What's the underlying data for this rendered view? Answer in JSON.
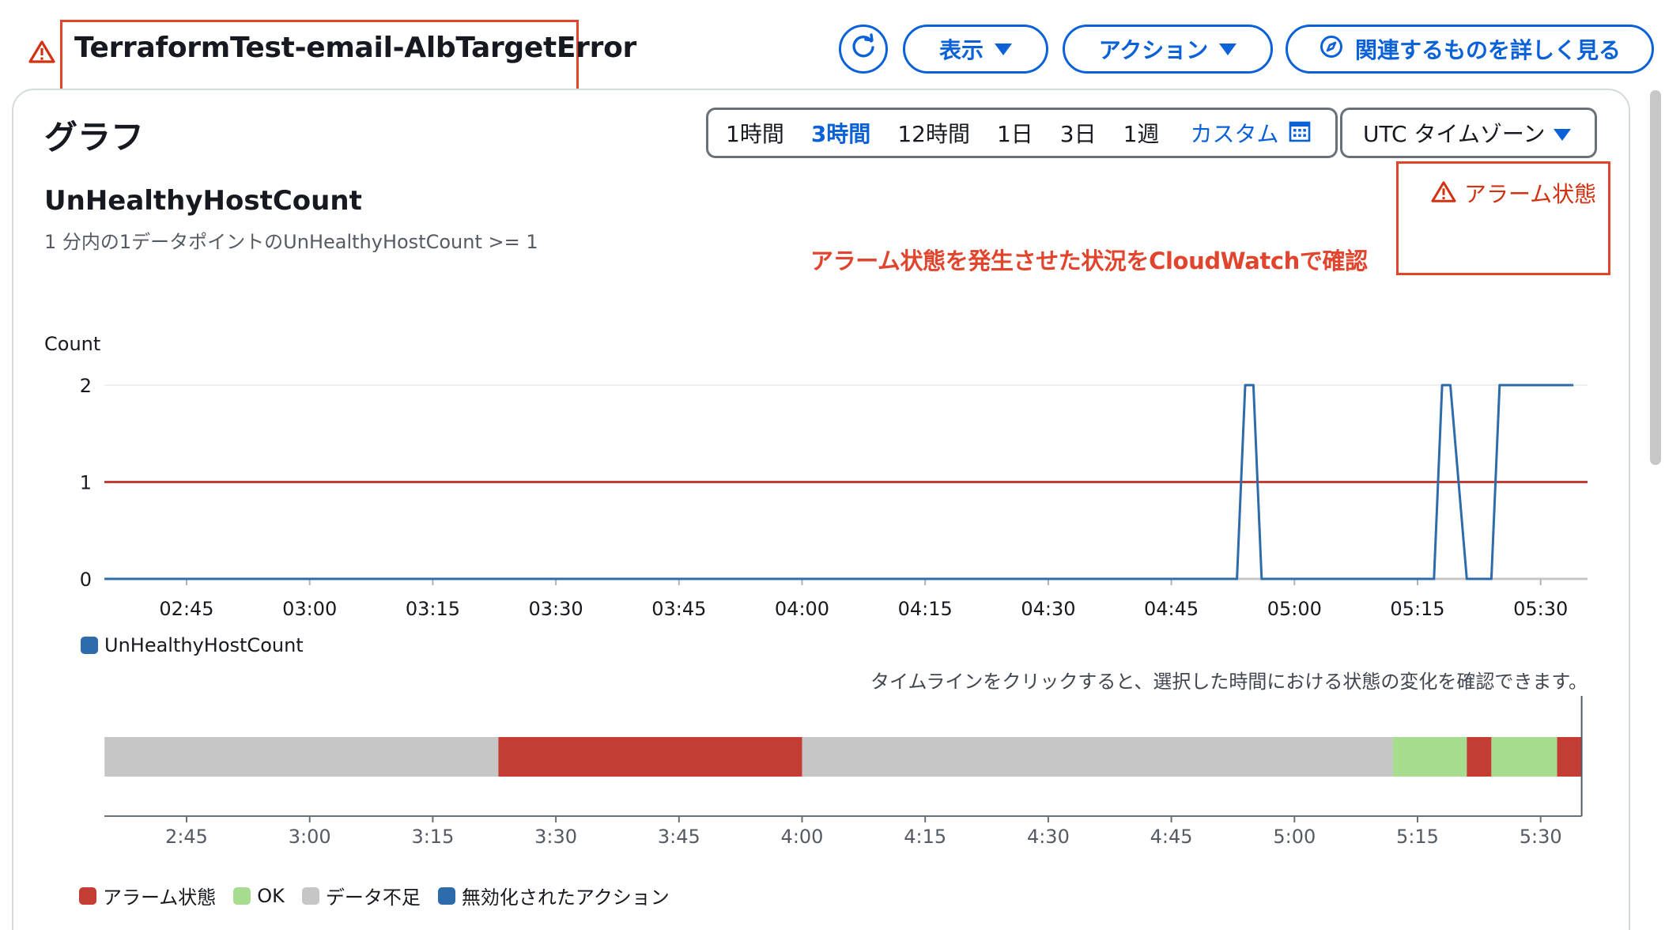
{
  "header": {
    "alarm_name": "TerraformTest-email-AlbTargetError",
    "buttons": {
      "view": "表示",
      "actions": "アクション",
      "related": "関連するものを詳しく見る"
    }
  },
  "graph": {
    "heading": "グラフ",
    "time_ranges": [
      "1時間",
      "3時間",
      "12時間",
      "1日",
      "3日",
      "1週",
      "カスタム"
    ],
    "selected_range": "3時間",
    "timezone": "UTC タイムゾーン",
    "metric_name": "UnHealthyHostCount",
    "condition": "1 分内の1データポイントのUnHealthyHostCount >= 1",
    "state_label": "アラーム状態",
    "annotation": "アラーム状態を発生させた状況をCloudWatchで確認",
    "timeline_hint": "タイムラインをクリックすると、選択した時間における状態の変化を確認できます。"
  },
  "chart_data": [
    {
      "type": "line",
      "ylabel": "Count",
      "ylim": [
        0,
        2
      ],
      "y_ticks": [
        "0",
        "1",
        "2"
      ],
      "x_ticks": [
        "02:45",
        "03:00",
        "03:15",
        "03:30",
        "03:45",
        "04:00",
        "04:15",
        "04:30",
        "04:45",
        "05:00",
        "05:15",
        "05:30"
      ],
      "threshold": 1,
      "series": [
        {
          "name": "UnHealthyHostCount",
          "color": "#2e6bab",
          "x": [
            "02:35",
            "04:53",
            "04:54",
            "04:55",
            "04:56",
            "05:17",
            "05:18",
            "05:19",
            "05:21",
            "05:24",
            "05:25",
            "05:34"
          ],
          "values": [
            0,
            0,
            2,
            2,
            0,
            0,
            2,
            2,
            0,
            0,
            2,
            2
          ]
        }
      ]
    },
    {
      "type": "timeline",
      "x_ticks": [
        "2:45",
        "3:00",
        "3:15",
        "3:30",
        "3:45",
        "4:00",
        "4:15",
        "4:30",
        "4:45",
        "5:00",
        "5:15",
        "5:30"
      ],
      "segments": [
        {
          "state": "insufficient",
          "start": "02:35",
          "end": "03:23"
        },
        {
          "state": "alarm",
          "start": "03:23",
          "end": "04:00"
        },
        {
          "state": "insufficient",
          "start": "04:00",
          "end": "05:12"
        },
        {
          "state": "ok",
          "start": "05:12",
          "end": "05:21"
        },
        {
          "state": "alarm",
          "start": "05:21",
          "end": "05:24"
        },
        {
          "state": "ok",
          "start": "05:24",
          "end": "05:32"
        },
        {
          "state": "alarm",
          "start": "05:32",
          "end": "05:35"
        }
      ],
      "legend": [
        {
          "key": "alarm",
          "label": "アラーム状態",
          "color": "#c33d35"
        },
        {
          "key": "ok",
          "label": "OK",
          "color": "#a6dd8f"
        },
        {
          "key": "insufficient",
          "label": "データ不足",
          "color": "#c6c6c6"
        },
        {
          "key": "disabled",
          "label": "無効化されたアクション",
          "color": "#2e6bab"
        }
      ]
    }
  ]
}
